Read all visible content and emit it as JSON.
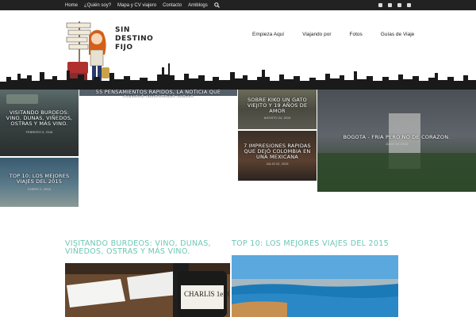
{
  "topbar": {
    "nav": [
      "Home",
      "¿Quién soy?",
      "Mapa y CV viajero",
      "Contacto",
      "Amiblogs"
    ],
    "icons": [
      "search-icon",
      "facebook-icon",
      "twitter-icon",
      "youtube-icon",
      "googleplus-icon"
    ]
  },
  "header": {
    "logo_lines": [
      "SIN",
      "DESTINO",
      "FIJO"
    ],
    "menu": [
      "Empieza Aquí",
      "Viajando por",
      "Fotos",
      "Guías de Viaje"
    ]
  },
  "featured": [
    {
      "title": "VISITANDO BURDEOS: VINO, DUNAS, VIÑEDOS, OSTRAS Y MÁS VINO.",
      "date": "FEBRERO 9, 2016"
    },
    {
      "title": "TOP 10: LOS MEJORES VIAJES DEL 2015",
      "date": "ENERO 1, 2016"
    },
    {
      "title": "55 PENSAMIENTOS RAPIDOS, LA NOTICIA QUE CAMBIÓ NUESTRAS VIDAS",
      "date": ""
    },
    {
      "title": "SOBRE KIKO UN GATO VIEJITO Y 19 AÑOS DE AMOR",
      "date": "AGOSTO 24, 2015"
    },
    {
      "title": "7 IMPRESIONES RAPIDAS QUE DEJÓ COLOMBIA EN UNA MEXICANA",
      "date": "JULIO 22, 2015"
    },
    {
      "title": "BOGOTA - FRIA PERO NO DE CORAZON.",
      "date": "JULIO 10, 2015"
    }
  ],
  "posts": [
    {
      "title": "VISITANDO BURDEOS: VINO, DUNAS, VIÑEDOS, OSTRAS Y MÁS VINO."
    },
    {
      "title": "TOP 10: LOS MEJORES VIAJES DEL 2015"
    }
  ],
  "colors": {
    "accent": "#6cc7b4",
    "topbar": "#222222"
  }
}
